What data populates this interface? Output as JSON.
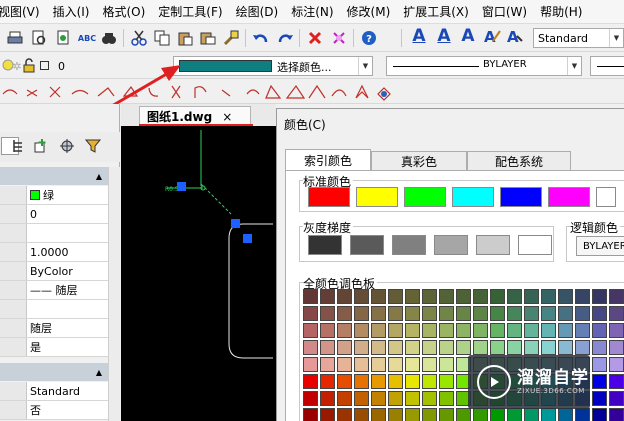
{
  "menu": [
    "视图(V)",
    "插入(I)",
    "格式(O)",
    "定制工具(F)",
    "绘图(D)",
    "标注(N)",
    "修改(M)",
    "扩展工具(X)",
    "窗口(W)",
    "帮助(H)"
  ],
  "toolbar": {
    "text_style_value": "Standard",
    "layer_value": "0",
    "color_combo_label": "选择颜色...",
    "linetype_value": "BYLAYER"
  },
  "document_tab": {
    "label": "图纸1.dwg",
    "close": "×"
  },
  "properties": {
    "rows_general": [
      "绿",
      "0",
      "",
      "1.0000",
      "ByColor",
      "—— 随层",
      "",
      "随层",
      "是"
    ],
    "rows_text": [
      "Standard",
      "否"
    ]
  },
  "dialog": {
    "title": "颜色(C)",
    "tabs": [
      "索引颜色",
      "真彩色",
      "配色系统"
    ],
    "active_tab": "索引颜色",
    "standard_label": "标准颜色",
    "gray_label": "灰度梯度",
    "logical_label": "逻辑颜色",
    "logical_button": "BYLAYER",
    "palette_label": "全颜色调色板",
    "standard_colors": [
      "#ff0000",
      "#ffff00",
      "#00ff00",
      "#00ffff",
      "#0000ff",
      "#ff00ff",
      "#ffffff"
    ],
    "gray_colors": [
      "#333333",
      "#5a5a5a",
      "#808080",
      "#a6a6a6",
      "#cccccc",
      "#ffffff"
    ]
  },
  "colors": {
    "layer_color_indicator": "#00ff00",
    "selected_color": "#0e7f80",
    "canvas_bg": "#000000",
    "annotation_arrow": "#e02020",
    "grip": "#1e5fff"
  },
  "watermark": {
    "name": "溜溜自学",
    "url": "ZIXUE.3D66.COM"
  }
}
